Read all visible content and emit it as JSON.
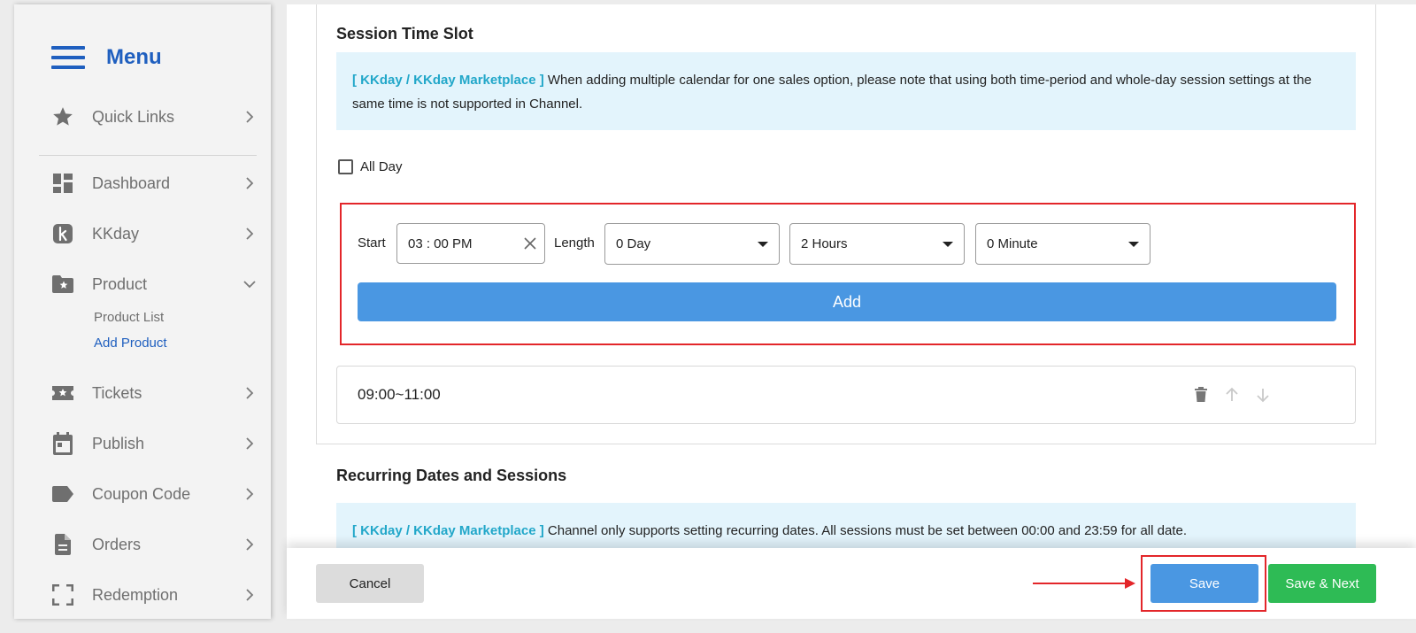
{
  "sidebar": {
    "title": "Menu",
    "items": [
      {
        "label": "Quick Links",
        "icon": "star-icon"
      },
      {
        "label": "Dashboard",
        "icon": "dashboard-icon"
      },
      {
        "label": "KKday",
        "icon": "kkday-logo-icon"
      },
      {
        "label": "Product",
        "icon": "folder-star-icon",
        "expanded": true
      },
      {
        "label": "Tickets",
        "icon": "ticket-icon"
      },
      {
        "label": "Publish",
        "icon": "calendar-icon"
      },
      {
        "label": "Coupon Code",
        "icon": "tag-icon"
      },
      {
        "label": "Orders",
        "icon": "document-icon"
      },
      {
        "label": "Redemption",
        "icon": "scan-icon"
      }
    ],
    "product_sub": [
      {
        "label": "Product List",
        "active": false
      },
      {
        "label": "Add Product",
        "active": true
      }
    ]
  },
  "session": {
    "title": "Session Time Slot",
    "notice_tag": "[ KKday / KKday Marketplace ]",
    "notice_text": " When adding multiple calendar for one sales option, please note that using both time-period and whole-day session settings at the same time is not supported in Channel.",
    "all_day_label": "All Day",
    "all_day_checked": false,
    "start_label": "Start",
    "start_value": "03 : 00 PM",
    "length_label": "Length",
    "day_value": "0 Day",
    "hours_value": "2 Hours",
    "minute_value": "0 Minute",
    "add_label": "Add",
    "slots": [
      {
        "time": "09:00~11:00"
      }
    ]
  },
  "recurring": {
    "title": "Recurring Dates and Sessions",
    "notice_tag": "[ KKday / KKday Marketplace ]",
    "notice_text": " Channel only supports setting recurring dates. All sessions must be set between 00:00 and 23:59 for all date."
  },
  "footer": {
    "cancel_label": "Cancel",
    "save_label": "Save",
    "save_next_label": "Save & Next"
  },
  "colors": {
    "brand_blue": "#1f5fbf",
    "button_blue": "#4a97e2",
    "green": "#2ebb55",
    "highlight_red": "#e3262a",
    "notice_bg": "#e3f4fc",
    "notice_tag": "#22a7c9"
  }
}
